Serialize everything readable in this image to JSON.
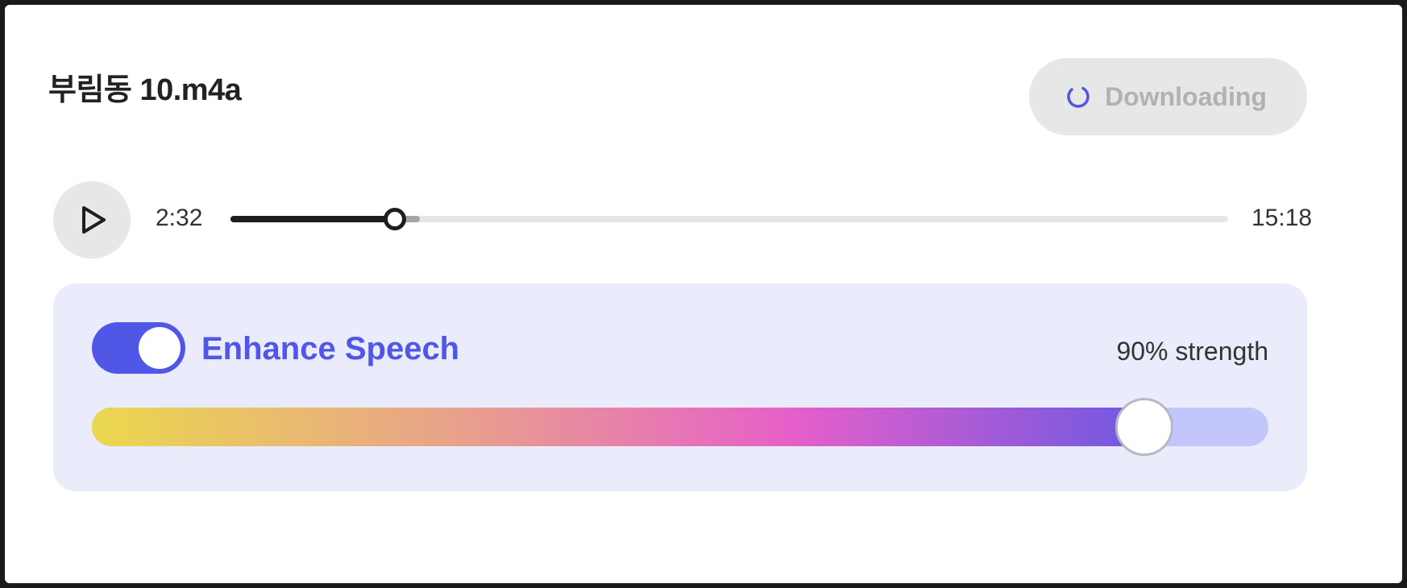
{
  "file": {
    "title": "부림동 10.m4a"
  },
  "download": {
    "label": "Downloading",
    "spinner_color": "#5057e6"
  },
  "player": {
    "play_icon": "play-icon",
    "current_time": "2:32",
    "total_time": "15:18",
    "progress": 0.165,
    "buffered": 0.19
  },
  "enhance": {
    "label": "Enhance Speech",
    "enabled": true,
    "strength_label": "90% strength",
    "strength": 0.9,
    "accent_color": "#5057e6",
    "gradient_colors": [
      "#ebd84e",
      "#e8a489",
      "#e65fca",
      "#6f58e2"
    ]
  }
}
